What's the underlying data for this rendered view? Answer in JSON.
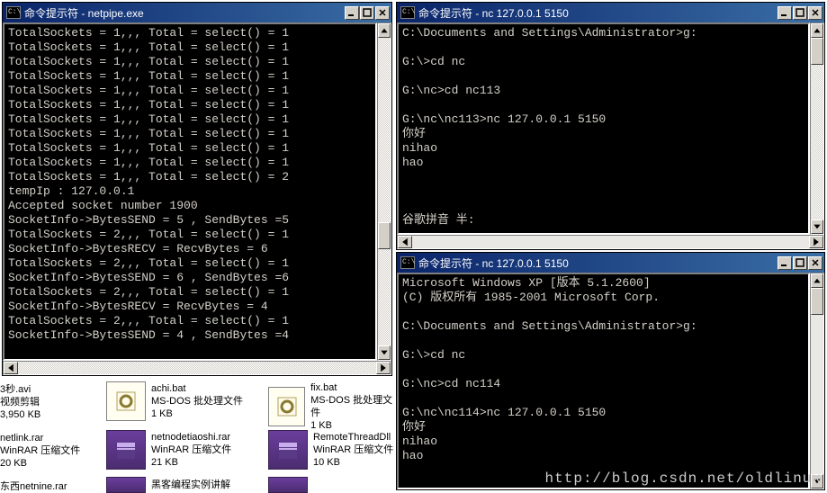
{
  "windows": {
    "w1": {
      "title": "命令提示符 - netpipe.exe",
      "lines": [
        "TotalSockets = 1,,, Total = select() = 1",
        "TotalSockets = 1,,, Total = select() = 1",
        "TotalSockets = 1,,, Total = select() = 1",
        "TotalSockets = 1,,, Total = select() = 1",
        "TotalSockets = 1,,, Total = select() = 1",
        "TotalSockets = 1,,, Total = select() = 1",
        "TotalSockets = 1,,, Total = select() = 1",
        "TotalSockets = 1,,, Total = select() = 1",
        "TotalSockets = 1,,, Total = select() = 1",
        "TotalSockets = 1,,, Total = select() = 1",
        "TotalSockets = 1,,, Total = select() = 2",
        "tempIp : 127.0.0.1",
        "Accepted socket number 1900",
        "SocketInfo->BytesSEND = 5 , SendBytes =5",
        "TotalSockets = 2,,, Total = select() = 1",
        "SocketInfo->BytesRECV = RecvBytes = 6",
        "TotalSockets = 2,,, Total = select() = 1",
        "SocketInfo->BytesSEND = 6 , SendBytes =6",
        "TotalSockets = 2,,, Total = select() = 1",
        "SocketInfo->BytesRECV = RecvBytes = 4",
        "TotalSockets = 2,,, Total = select() = 1",
        "SocketInfo->BytesSEND = 4 , SendBytes =4"
      ]
    },
    "w2": {
      "title": "命令提示符 - nc 127.0.0.1 5150",
      "lines": [
        "C:\\Documents and Settings\\Administrator>g:",
        "",
        "G:\\>cd nc",
        "",
        "G:\\nc>cd nc113",
        "",
        "G:\\nc\\nc113>nc 127.0.0.1 5150",
        "你好",
        "nihao",
        "hao",
        "",
        "",
        "",
        "谷歌拼音 半:"
      ]
    },
    "w3": {
      "title": "命令提示符 - nc 127.0.0.1 5150",
      "lines": [
        "Microsoft Windows XP [版本 5.1.2600]",
        "(C) 版权所有 1985-2001 Microsoft Corp.",
        "",
        "C:\\Documents and Settings\\Administrator>g:",
        "",
        "G:\\>cd nc",
        "",
        "G:\\nc>cd nc114",
        "",
        "G:\\nc\\nc114>nc 127.0.0.1 5150",
        "你好",
        "nihao",
        "hao",
        ""
      ]
    }
  },
  "files": [
    {
      "name": "3秒.avi",
      "type": "视频剪辑",
      "size": "3,950 KB",
      "kind": "folder"
    },
    {
      "name": "achi.bat",
      "type": "MS-DOS 批处理文件",
      "size": "1 KB",
      "kind": "bat"
    },
    {
      "name": "fix.bat",
      "type": "MS-DOS 批处理文件",
      "size": "1 KB",
      "kind": "bat"
    },
    {
      "name": "netlink.rar",
      "type": "WinRAR 压缩文件",
      "size": "20 KB",
      "kind": "rar"
    },
    {
      "name": "netnodetiaoshi.rar",
      "type": "WinRAR 压缩文件",
      "size": "21 KB",
      "kind": "rar"
    },
    {
      "name": "RemoteThreadDll",
      "type": "WinRAR 压缩文件",
      "size": "10 KB",
      "kind": "rar"
    },
    {
      "name": "东西netnine.rar",
      "type": "",
      "size": "",
      "kind": "rar"
    },
    {
      "name": "黑客编程实例讲解",
      "type": "",
      "size": "",
      "kind": "rar"
    }
  ],
  "watermark": "http://blog.csdn.net/oldlinux",
  "icon_label": "C:\\"
}
